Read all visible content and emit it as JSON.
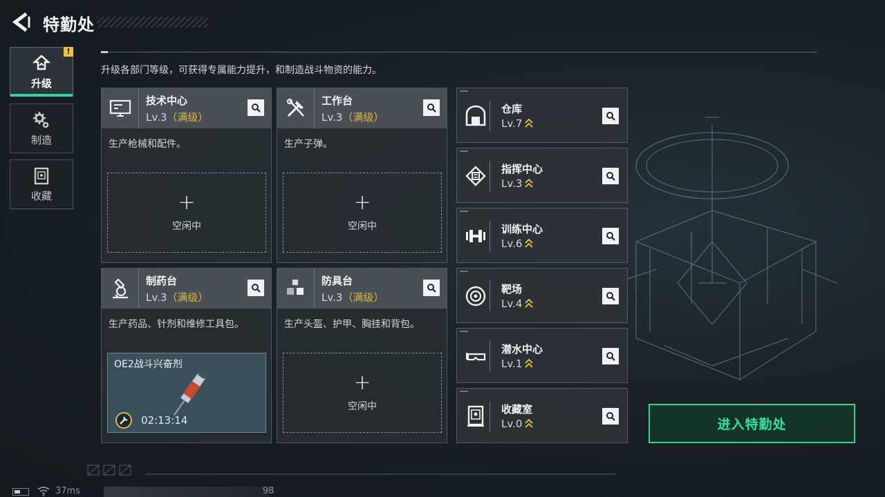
{
  "header": {
    "title": "特勤处"
  },
  "sidebar": {
    "items": [
      {
        "label": "升级",
        "icon": "upgrade-icon",
        "active": true,
        "alert": "!"
      },
      {
        "label": "制造",
        "icon": "gears-icon",
        "active": false
      },
      {
        "label": "收藏",
        "icon": "collection-icon",
        "active": false
      }
    ]
  },
  "description": "升级各部门等级，可获得专属能力提升，和制造战斗物资的能力。",
  "cards": [
    {
      "name": "技术中心",
      "level": "Lv.3",
      "max": "（满级）",
      "icon": "monitor-icon",
      "desc": "生产枪械和配件。",
      "slot": {
        "plus": "+",
        "idle": "空闲中"
      }
    },
    {
      "name": "工作台",
      "level": "Lv.3",
      "max": "（满级）",
      "icon": "tools-icon",
      "desc": "生产子弹。",
      "slot": {
        "plus": "+",
        "idle": "空闲中"
      }
    },
    {
      "name": "制药台",
      "level": "Lv.3",
      "max": "（满级）",
      "icon": "microscope-icon",
      "desc": "生产药品、针剂和维修工具包。",
      "production": {
        "item": "OE2战斗兴奋剂",
        "time": "02:13:14"
      }
    },
    {
      "name": "防具台",
      "level": "Lv.3",
      "max": "（满级）",
      "icon": "cubes-icon",
      "desc": "生产头盔、护甲、胸挂和背包。",
      "slot": {
        "plus": "+",
        "idle": "空闲中"
      }
    }
  ],
  "facilities": [
    {
      "name": "仓库",
      "level": "Lv.7",
      "icon": "warehouse-icon"
    },
    {
      "name": "指挥中心",
      "level": "Lv.3",
      "icon": "chip-icon"
    },
    {
      "name": "训练中心",
      "level": "Lv.6",
      "icon": "dumbbell-icon"
    },
    {
      "name": "靶场",
      "level": "Lv.4",
      "icon": "target-icon"
    },
    {
      "name": "潜水中心",
      "level": "Lv.1",
      "icon": "goggles-icon"
    },
    {
      "name": "收藏室",
      "level": "Lv.0",
      "icon": "display-case-icon"
    }
  ],
  "enter_button": "进入特勤处",
  "status": {
    "ping": "37ms",
    "fps": "98"
  },
  "colors": {
    "accent": "#2fd394",
    "max_level": "#e3b63c",
    "alert": "#e9c23a"
  }
}
